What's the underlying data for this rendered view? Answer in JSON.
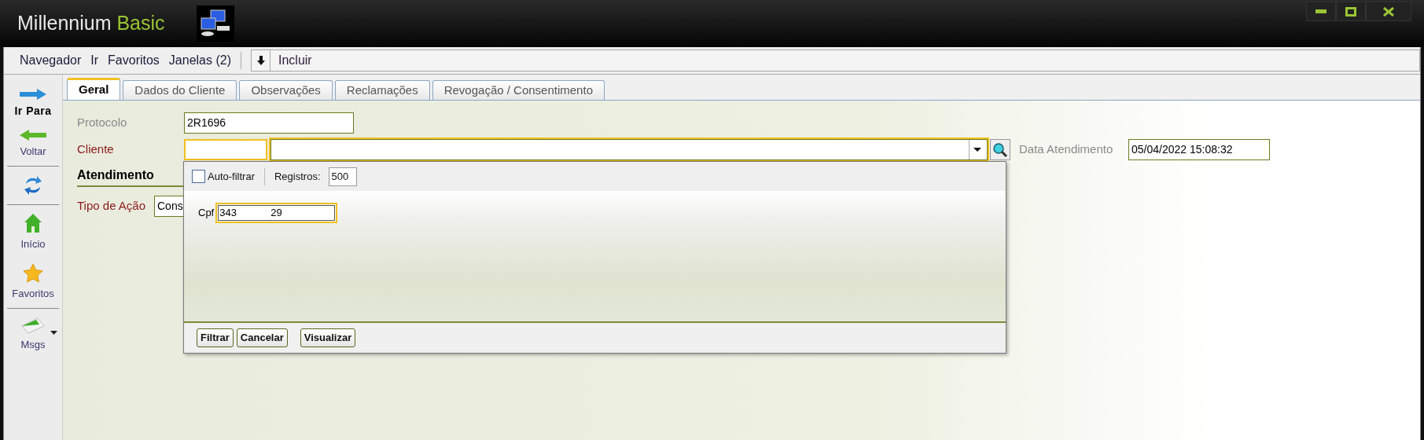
{
  "window": {
    "title": "Millennium",
    "title_accent": "Basic"
  },
  "menu": [
    {
      "label": "Navegador"
    },
    {
      "label": "Ir"
    },
    {
      "label": "Favoritos"
    },
    {
      "label": "Janelas (2)"
    }
  ],
  "toolbar": {
    "label": "Incluir"
  },
  "sidebar": {
    "groups": [
      [
        {
          "kind": "forward",
          "label": "Ir Para",
          "bold": true
        },
        {
          "kind": "back",
          "label": "Voltar",
          "bold": false
        }
      ],
      [
        {
          "kind": "refresh"
        }
      ],
      [
        {
          "kind": "home",
          "label": "Início",
          "bold": false
        },
        {
          "kind": "favorites",
          "label": "Favoritos",
          "bold": false
        }
      ],
      [
        {
          "kind": "messages",
          "label": "Msgs",
          "bold": false,
          "dropdown": true
        }
      ]
    ]
  },
  "tabs": [
    {
      "label": "Geral",
      "selected": true
    },
    {
      "label": "Dados do Cliente",
      "selected": false
    },
    {
      "label": "Observações",
      "selected": false
    },
    {
      "label": "Reclamações",
      "selected": false
    },
    {
      "label": "Revogação / Consentimento",
      "selected": false
    }
  ],
  "form": {
    "protocolo": {
      "label": "Protocolo",
      "value": "2R1696",
      "required": false
    },
    "cliente": {
      "label": "Cliente",
      "required": true,
      "focused": true
    },
    "data_atendimento": {
      "label": "Data Atendimento",
      "value": "05/04/2022 15:08:32",
      "required": false
    },
    "section": "Atendimento",
    "tipo_acao": {
      "label": "Tipo de Ação",
      "value": "Cons",
      "required": true
    }
  },
  "popup": {
    "auto_filter": {
      "label": "Auto-filtrar",
      "checked": false
    },
    "records": {
      "label": "Registros:",
      "value": "500"
    },
    "filters": [
      {
        "label": "Cpf",
        "value": "343            29",
        "focused": true
      }
    ],
    "buttons": [
      "Filtrar",
      "Cancelar",
      "Visualizar"
    ]
  }
}
